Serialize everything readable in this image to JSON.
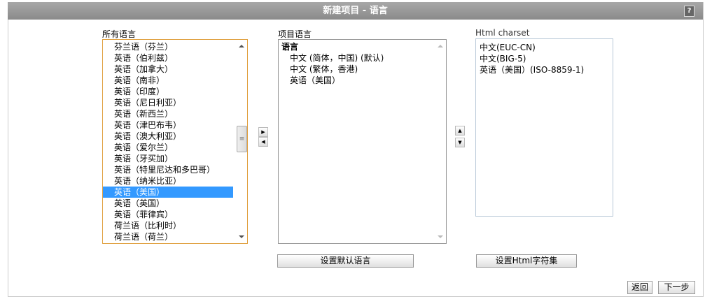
{
  "title": "新建项目 - 语言",
  "help_label": "?",
  "all_languages": {
    "label": "所有语言",
    "items": [
      "芬兰语（芬兰）",
      "英语（伯利兹）",
      "英语（加拿大）",
      "英语（南非）",
      "英语（印度）",
      "英语（尼日利亚）",
      "英语（新西兰）",
      "英语（津巴布韦）",
      "英语（澳大利亚）",
      "英语（爱尔兰）",
      "英语（牙买加）",
      "英语（特里尼达和多巴哥）",
      "英语（纳米比亚）",
      "英语（美国）",
      "英语（英国）",
      "英语（菲律宾）",
      "荷兰语（比利时）",
      "荷兰语（荷兰）"
    ],
    "selected_index": 13
  },
  "project_languages": {
    "label": "项目语言",
    "header": "语言",
    "items": [
      "中文 (简体，中国) (默认)",
      "中文 (繁体，香港)",
      "英语（美国）"
    ]
  },
  "charset": {
    "label": "Html charset",
    "items": [
      "中文(EUC-CN)",
      "中文(BIG-5)",
      "英语（美国）(ISO-8859-1)"
    ]
  },
  "buttons": {
    "add": "▶",
    "remove": "◀",
    "up": "▲",
    "down": "▼",
    "set_default": "设置默认语言",
    "set_charset": "设置Html字符集",
    "back": "返回",
    "next": "下一步"
  }
}
